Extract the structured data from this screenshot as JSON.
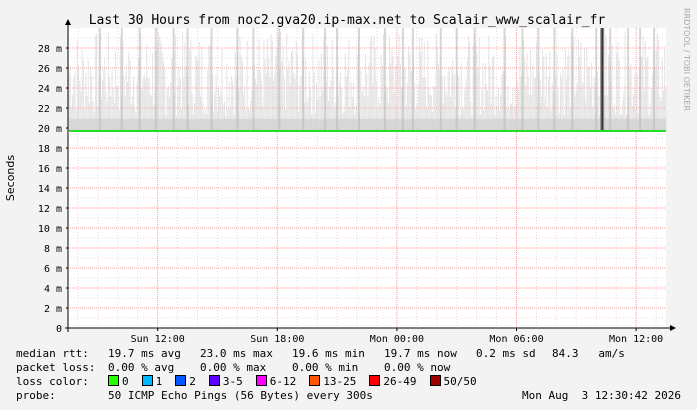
{
  "chart_data": {
    "type": "line",
    "title": "Last 30 Hours from noc2.gva20.ip-max.net to Scalair_www_scalair_fr",
    "ylabel": "Seconds",
    "watermark": "RRDTOOL / TOBI OETIKER",
    "y_ticks": [
      "0",
      "2 m",
      "4 m",
      "6 m",
      "8 m",
      "10 m",
      "12 m",
      "14 m",
      "16 m",
      "18 m",
      "20 m",
      "22 m",
      "24 m",
      "26 m",
      "28 m"
    ],
    "ylim": [
      0,
      30
    ],
    "x_ticks": [
      "Sun 12:00",
      "Sun 18:00",
      "Mon 00:00",
      "Mon 06:00",
      "Mon 12:00"
    ],
    "x_tick_hours": [
      4.5,
      10.5,
      16.5,
      22.5,
      28.5
    ],
    "xlim_hours": [
      0,
      30
    ],
    "grid": true,
    "series": [
      {
        "name": "median rtt",
        "color": "#22dd22",
        "median_value": 19.7
      }
    ],
    "smoke_color": "#888888",
    "spike_hours": [
      1.6,
      2.7,
      3.6,
      4.4,
      5.3,
      6.0,
      7.2,
      8.5,
      9.3,
      10.6,
      11.8,
      12.9,
      13.5,
      14.6,
      15.9,
      16.8,
      17.3,
      18.7,
      19.5,
      20.4,
      21.9,
      22.8,
      23.6,
      24.4,
      25.3,
      26.5,
      27.2,
      28.1,
      28.7,
      29.4
    ],
    "dark_spike_hours": [
      26.8
    ]
  },
  "legend": {
    "median": {
      "label": "median rtt:",
      "avg": "19.7 ms avg",
      "max": "23.0 ms max",
      "min": "19.6 ms min",
      "now": "19.7 ms now",
      "sd": "0.2 ms sd",
      "am": "84.3   am/s"
    },
    "loss": {
      "label": "packet loss:",
      "avg": "0.00 % avg",
      "max": "0.00 % max",
      "min": "0.00 % min",
      "now": "0.00 % now"
    },
    "loss_color": {
      "label": "loss color:",
      "items": [
        {
          "label": "0",
          "color": "#26ff00"
        },
        {
          "label": "1",
          "color": "#00b8ff"
        },
        {
          "label": "2",
          "color": "#0059ff"
        },
        {
          "label": "3-5",
          "color": "#5e00ff"
        },
        {
          "label": "6-12",
          "color": "#ff00ff"
        },
        {
          "label": "13-25",
          "color": "#ff5500"
        },
        {
          "label": "26-49",
          "color": "#ff0000"
        },
        {
          "label": "50/50",
          "color": "#a10000"
        }
      ]
    },
    "probe": {
      "label": "probe:",
      "text": "50 ICMP Echo Pings (56 Bytes) every 300s",
      "timestamp": "Mon Aug  3 12:30:42 2026"
    }
  }
}
